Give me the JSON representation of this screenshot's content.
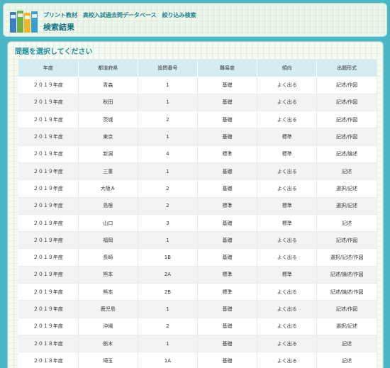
{
  "header": {
    "subtitle": "プリント教材　高校入試過去問データベース　絞り込み検索",
    "title": "検索結果",
    "colors": {
      "accent": "#4ab7c4",
      "title": "#0f6f7c"
    }
  },
  "panel": {
    "title": "問題を選択してください"
  },
  "table": {
    "columns": [
      "年度",
      "都道府県",
      "設問番号",
      "難易度",
      "傾向",
      "出題形式"
    ],
    "rows": [
      [
        "２０１９年度",
        "青森",
        "1",
        "基礎",
        "よく出る",
        "記述/作図"
      ],
      [
        "２０１９年度",
        "秋田",
        "1",
        "基礎",
        "よく出る",
        "記述/作図"
      ],
      [
        "２０１９年度",
        "茨城",
        "2",
        "基礎",
        "よく出る",
        "記述/作図"
      ],
      [
        "２０１９年度",
        "東京",
        "1",
        "基礎",
        "標準",
        "記述/作図"
      ],
      [
        "２０１９年度",
        "新潟",
        "4",
        "標準",
        "標準",
        "記述/論述"
      ],
      [
        "２０１９年度",
        "三重",
        "1",
        "基礎",
        "よく出る",
        "記述"
      ],
      [
        "２０１９年度",
        "大阪Ａ",
        "2",
        "基礎",
        "よく出る",
        "選択/記述"
      ],
      [
        "２０１９年度",
        "島根",
        "2",
        "標準",
        "標準",
        "選択/記述"
      ],
      [
        "２０１９年度",
        "山口",
        "3",
        "基礎",
        "標準",
        "記述"
      ],
      [
        "２０１９年度",
        "福岡",
        "1",
        "基礎",
        "よく出る",
        "記述/作図"
      ],
      [
        "２０１９年度",
        "長崎",
        "1B",
        "基礎",
        "よく出る",
        "選択/記述/作図"
      ],
      [
        "２０１９年度",
        "熊本",
        "2A",
        "標準",
        "標準",
        "記述/論述/作図"
      ],
      [
        "２０１９年度",
        "熊本",
        "2B",
        "標準",
        "よく出る",
        "記述/論述/作図"
      ],
      [
        "２０１９年度",
        "鹿児島",
        "1",
        "基礎",
        "よく出る",
        "記述/作図"
      ],
      [
        "２０１９年度",
        "沖縄",
        "2",
        "基礎",
        "よく出る",
        "選択/記述"
      ],
      [
        "２０１８年度",
        "栃木",
        "1",
        "基礎",
        "よく出る",
        "記述"
      ],
      [
        "２０１８年度",
        "埼玉",
        "1A",
        "基礎",
        "よく出る",
        "記述"
      ]
    ]
  }
}
